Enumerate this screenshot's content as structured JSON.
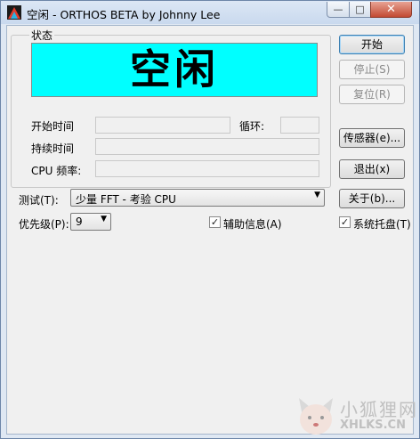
{
  "window": {
    "title": "空闲 - ORTHOS BETA by Johnny Lee",
    "minimize_glyph": "—",
    "maximize_glyph": "□",
    "close_glyph": "✕"
  },
  "status_group": {
    "label": "状态",
    "display": "空闲",
    "start_time_label": "开始时间",
    "loop_label": "循环:",
    "duration_label": "持续时间",
    "cpu_freq_label": "CPU 频率:"
  },
  "buttons": {
    "start": "开始",
    "stop": "停止(S)",
    "reset": "复位(R)",
    "sensors": "传感器(e)...",
    "exit": "退出(x)",
    "about": "关于(b)..."
  },
  "test": {
    "label": "测试(T):",
    "value": "少量 FFT  - 考验 CPU"
  },
  "priority": {
    "label": "优先级(P):",
    "value": "9"
  },
  "options": {
    "aux_info_label": "辅助信息(A)",
    "aux_info_checked": true,
    "tray_label": "系统托盘(T)",
    "tray_checked": true,
    "check_glyph": "✓",
    "dropdown_glyph": "▼"
  },
  "watermark": {
    "text": "小狐狸网",
    "domain": "XHLKS.CN"
  },
  "colors": {
    "status_bg": "#00ffff",
    "close_btn": "#c24a33"
  }
}
